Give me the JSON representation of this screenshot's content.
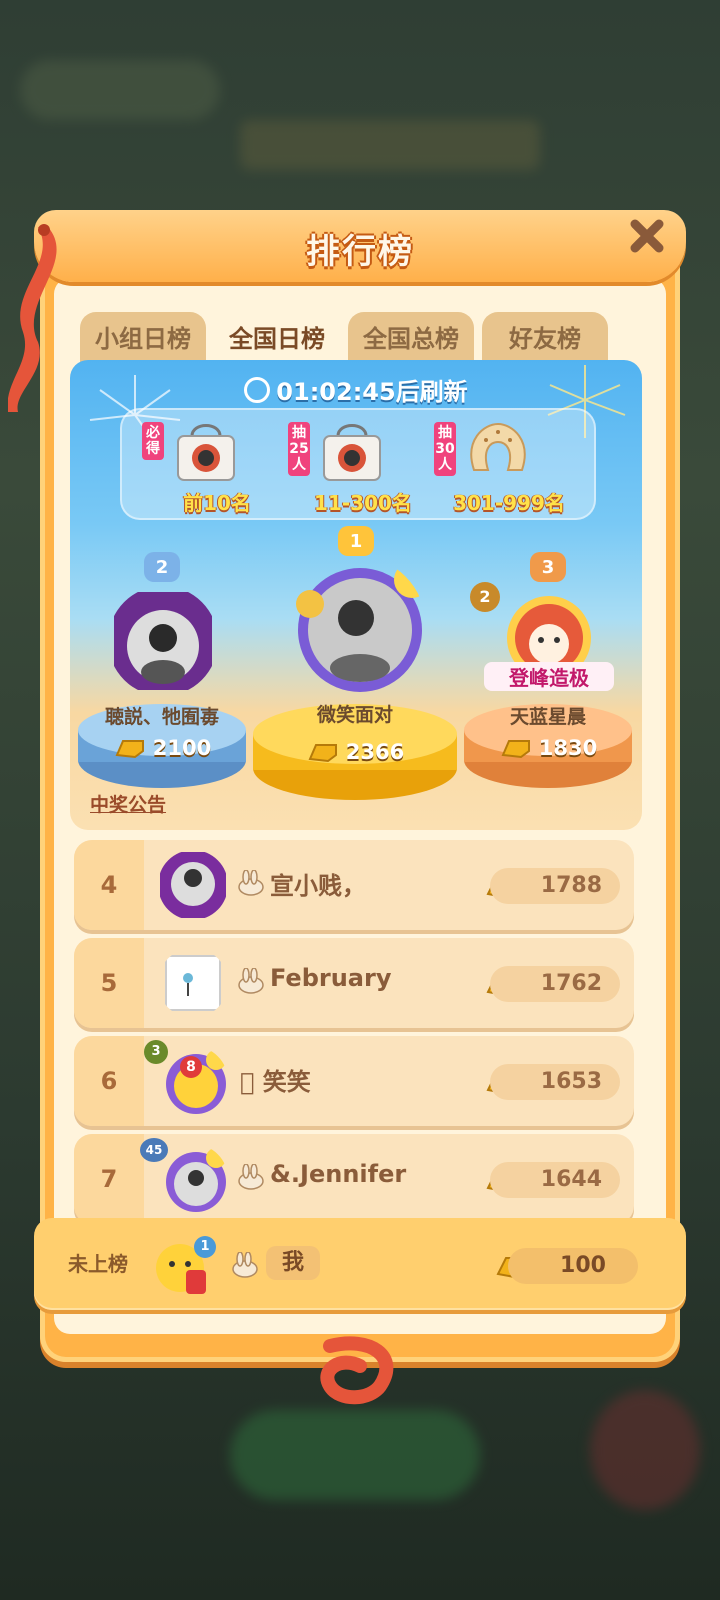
{
  "title": "排行榜",
  "tabs": [
    {
      "label": "小组日榜",
      "active": false
    },
    {
      "label": "全国日榜",
      "active": true
    },
    {
      "label": "全国总榜",
      "active": false
    },
    {
      "label": "好友榜",
      "active": false
    }
  ],
  "timer": {
    "countdown": "01:02:45",
    "suffix": "后刷新"
  },
  "prizes": [
    {
      "tag": "必得",
      "label": "前10名",
      "icon": "bag-icon"
    },
    {
      "tag": "抽25人",
      "label": "11-300名",
      "icon": "bag-icon"
    },
    {
      "tag": "抽30人",
      "label": "301-999名",
      "icon": "neck-pillow-icon"
    }
  ],
  "podium": [
    {
      "rank": "2",
      "name": "聴説、牠囿毐",
      "score": "2100"
    },
    {
      "rank": "1",
      "name": "微笑面对",
      "score": "2366"
    },
    {
      "rank": "3",
      "name": "天蓝星晨",
      "score": "1830",
      "level": "2",
      "frame_text": "登峰造极"
    }
  ],
  "announcement": "中奖公告",
  "list": [
    {
      "rank": "4",
      "name": "宣小贱，",
      "score": "1788"
    },
    {
      "rank": "5",
      "name": "February",
      "score": "1762"
    },
    {
      "rank": "6",
      "name": "󰀀 笑笑",
      "score": "1653",
      "level": "3",
      "badge": "8"
    },
    {
      "rank": "7",
      "name": "&.Jennifer",
      "score": "1644",
      "level": "45"
    }
  ],
  "me": {
    "rank": "未上榜",
    "name": "我",
    "score": "100",
    "level": "1"
  },
  "colors": {
    "panel": "#ffb347",
    "accent": "#ffe24a",
    "text": "#8a5c3a"
  }
}
